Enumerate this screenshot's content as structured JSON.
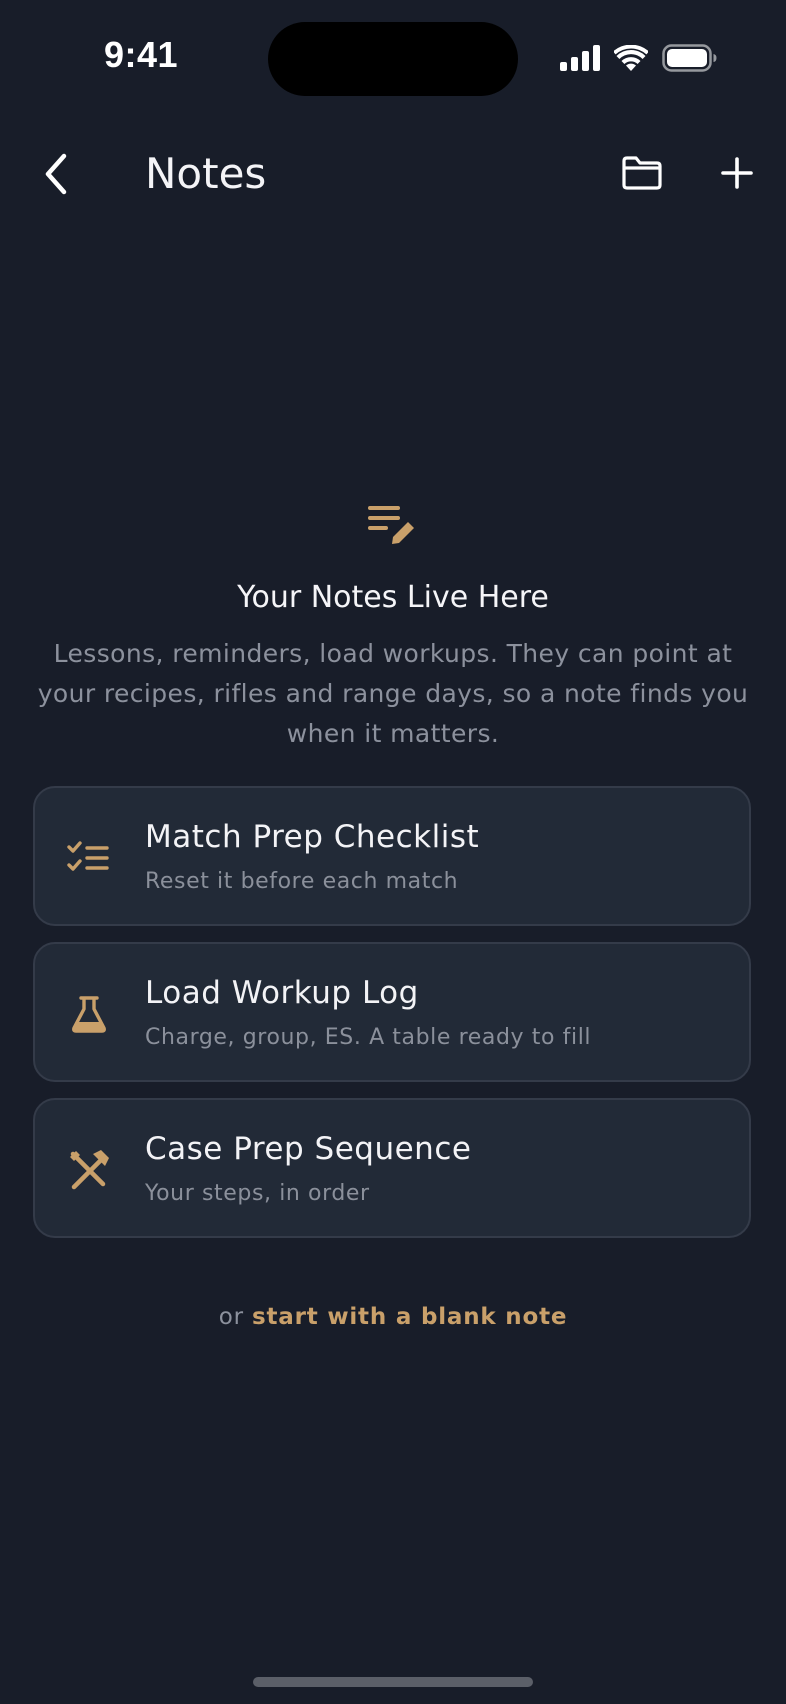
{
  "status_bar": {
    "time": "9:41"
  },
  "nav": {
    "title": "Notes",
    "back_icon": "chevron-left-icon",
    "folder_icon": "folder-icon",
    "add_icon": "plus-icon"
  },
  "empty_state": {
    "icon": "notes-edit-icon",
    "title": "Your Notes Live Here",
    "body": "Lessons, reminders, load workups. They can point at your recipes, rifles and range days, so a note finds you when it matters."
  },
  "templates": [
    {
      "icon": "checklist-icon",
      "title": "Match Prep Checklist",
      "subtitle": "Reset it before each match"
    },
    {
      "icon": "flask-icon",
      "title": "Load Workup Log",
      "subtitle": "Charge, group, ES. A table ready to fill"
    },
    {
      "icon": "tools-icon",
      "title": "Case Prep Sequence",
      "subtitle": "Your steps, in order"
    }
  ],
  "blank_note": {
    "prefix": "or ",
    "link": "start with a blank note"
  },
  "colors": {
    "background": "#181d29",
    "card": "#222a37",
    "card_border": "#343b49",
    "accent": "#c9a06a",
    "muted_text": "#8c919d"
  }
}
